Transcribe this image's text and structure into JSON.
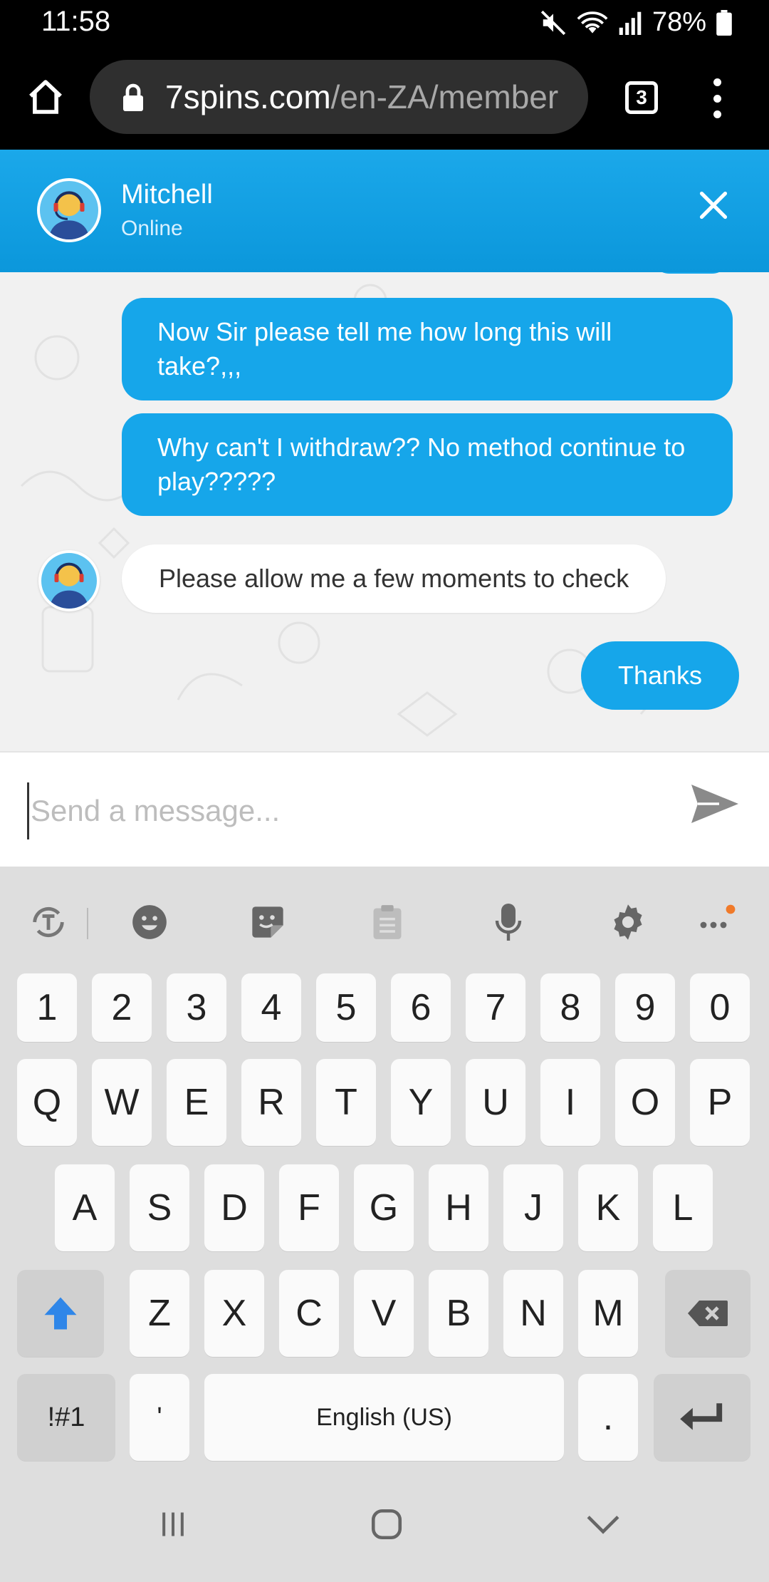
{
  "status_bar": {
    "time": "11:58",
    "battery": "78%"
  },
  "browser": {
    "url_domain": "7spins.com",
    "url_path": "/en-ZA/member",
    "tab_count": "3"
  },
  "chat_header": {
    "agent_name": "Mitchell",
    "agent_status": "Online"
  },
  "messages": [
    {
      "from": "user",
      "text": "Now Sir please tell me how long this will take?,,,"
    },
    {
      "from": "user",
      "text": "Why can't I withdraw?? No method continue to play?????"
    },
    {
      "from": "agent",
      "text": "Please allow me a few moments to check"
    },
    {
      "from": "user",
      "text": "Thanks"
    }
  ],
  "composer": {
    "placeholder": "Send a message..."
  },
  "keyboard": {
    "number_row": [
      "1",
      "2",
      "3",
      "4",
      "5",
      "6",
      "7",
      "8",
      "9",
      "0"
    ],
    "row1": [
      "Q",
      "W",
      "E",
      "R",
      "T",
      "Y",
      "U",
      "I",
      "O",
      "P"
    ],
    "row2": [
      "A",
      "S",
      "D",
      "F",
      "G",
      "H",
      "J",
      "K",
      "L"
    ],
    "row3": [
      "Z",
      "X",
      "C",
      "V",
      "B",
      "N",
      "M"
    ],
    "symbols_key": "!#1",
    "apostrophe_key": "'",
    "space_key": "English (US)",
    "period_key": "."
  },
  "colors": {
    "accent": "#16a6ea",
    "header": "#0b97db",
    "shift": "#2f86e8",
    "notification_dot": "#f07a2a"
  }
}
